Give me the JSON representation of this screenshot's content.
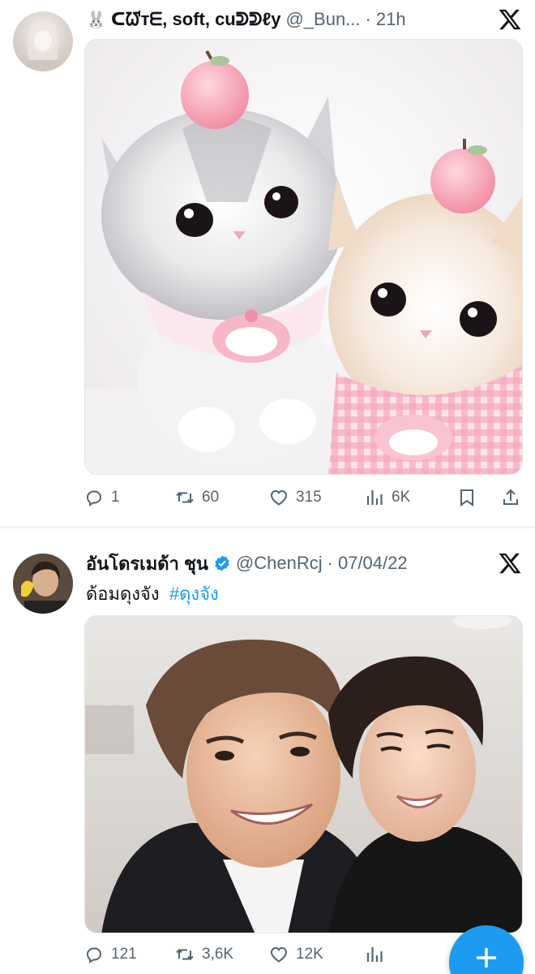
{
  "feed": {
    "tweets": [
      {
        "emoji": "🐰",
        "display_name": "ᑕᘺᴛᗴ, soft, cuᕲᕲℓy",
        "handle": "@_Bun...",
        "dot": "·",
        "time": "21h",
        "text": "",
        "hashtag": "",
        "media_description": "Two fluffy kittens wearing bibs with peaches on their heads",
        "actions": {
          "replies": "1",
          "retweets": "60",
          "likes": "315",
          "views": "6K"
        }
      },
      {
        "display_name": "อันโดรเมด้า ชุน",
        "handle": "@ChenRcj",
        "dot": "·",
        "time": "07/04/22",
        "text": "ด้อมดุงจัง",
        "hashtag": "#ดุงจัง",
        "media_description": "Selfie of two smiling young men",
        "actions": {
          "replies": "121",
          "retweets": "3,6K",
          "likes": "12K",
          "views": ""
        }
      }
    ]
  },
  "colors": {
    "text": "#0f1419",
    "muted": "#536471",
    "accent": "#1d9bf0",
    "verified": "#1d9bf0",
    "separator": "#eff3f4"
  },
  "icons": {
    "reply": "reply-icon",
    "retweet": "retweet-icon",
    "like": "heart-icon",
    "views": "views-chart-icon",
    "bookmark": "bookmark-icon",
    "share": "share-icon",
    "platform": "x-logo-icon",
    "compose": "plus-icon"
  }
}
